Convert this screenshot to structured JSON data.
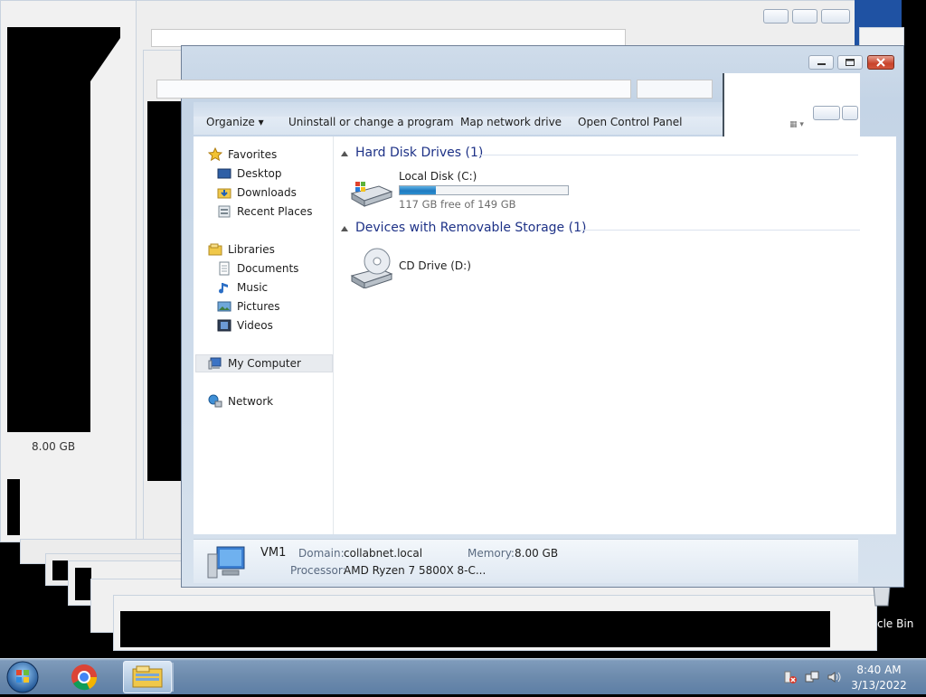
{
  "window": {
    "toolbar": {
      "organize": "Organize",
      "uninstall": "Uninstall or change a program",
      "map_drive": "Map network drive",
      "control_panel": "Open Control Panel"
    },
    "nav": {
      "favorites": "Favorites",
      "desktop": "Desktop",
      "downloads": "Downloads",
      "recent": "Recent Places",
      "libraries": "Libraries",
      "documents": "Documents",
      "music": "Music",
      "pictures": "Pictures",
      "videos": "Videos",
      "computer": "My Computer",
      "network": "Network"
    },
    "content": {
      "hdd_group": "Hard Disk Drives (1)",
      "removable_group": "Devices with Removable Storage (1)",
      "local_disk": "Local Disk (C:)",
      "local_disk_free": "117 GB free of 149 GB",
      "local_disk_used_fraction": 0.215,
      "cd_drive": "CD Drive (D:)"
    },
    "details": {
      "name": "VM1",
      "domain_label": "Domain:",
      "domain_value": "collabnet.local",
      "memory_label": "Memory:",
      "memory_value": "8.00 GB",
      "processor_label": "Processor:",
      "processor_value": "AMD Ryzen 7 5800X 8-C..."
    }
  },
  "background": {
    "ghost_memory": "8.00 GB",
    "recycle_bin_fragment": "cle Bin"
  },
  "taskbar": {
    "time": "8:40 AM",
    "date": "3/13/2022"
  },
  "colors": {
    "accent": "#1e3287",
    "progress": "#2b8fd0",
    "taskbar": "#6d8bad"
  }
}
